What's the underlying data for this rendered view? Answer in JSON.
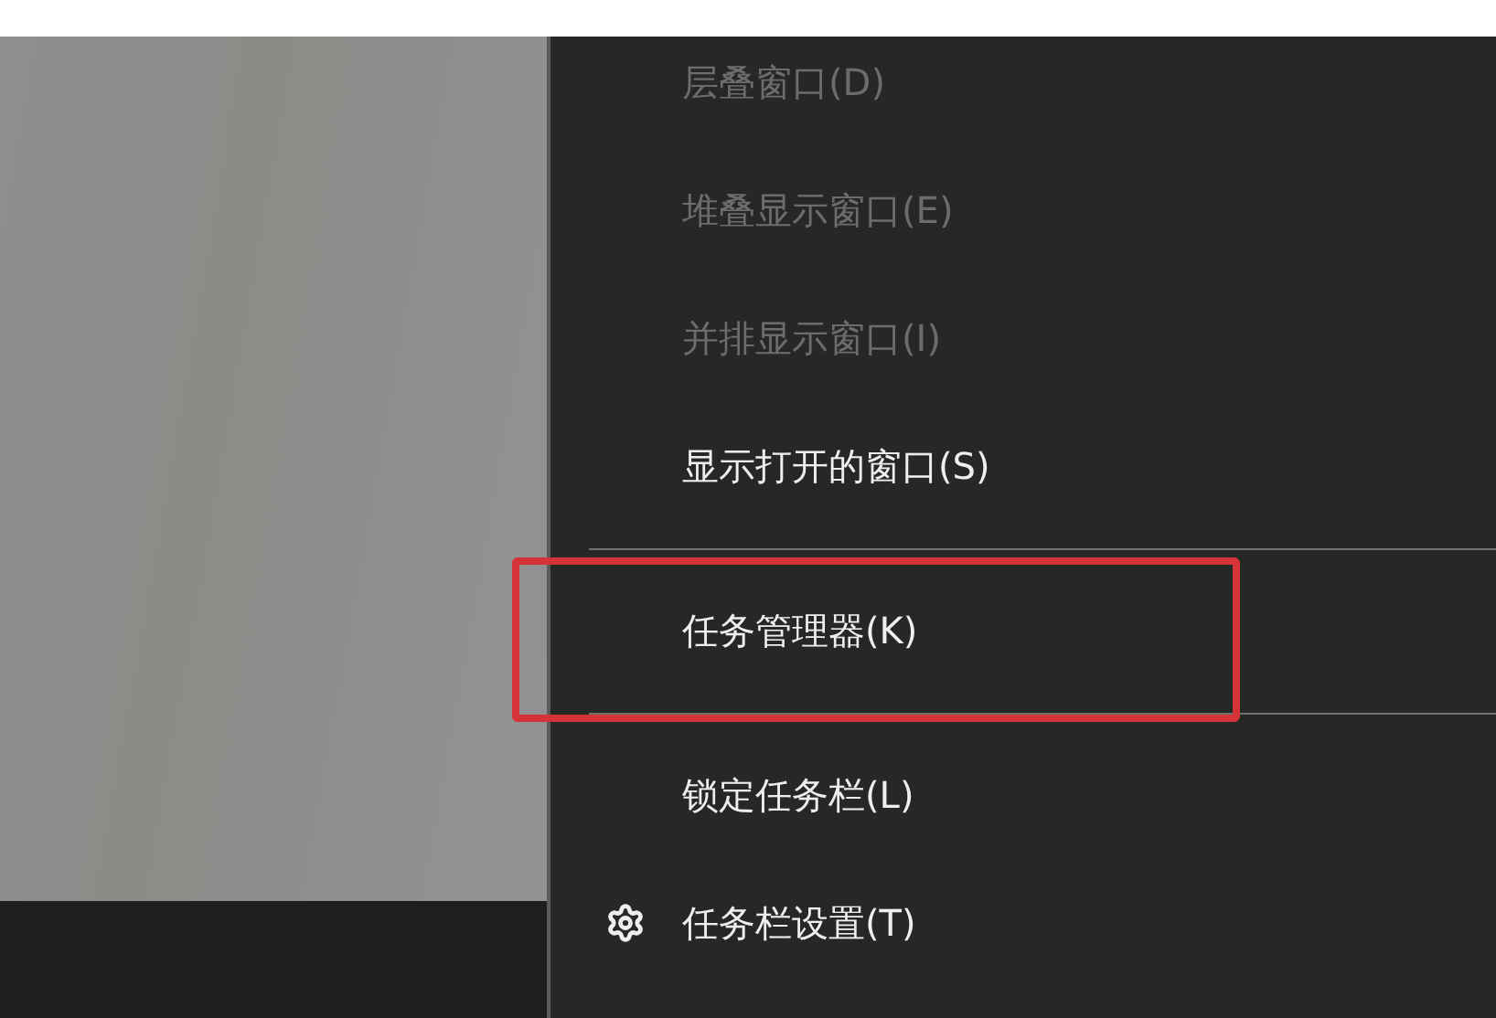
{
  "context_menu": {
    "items": [
      {
        "kind": "item",
        "label": "层叠窗口(D)",
        "disabled": true,
        "highlighted": false
      },
      {
        "kind": "item",
        "label": "堆叠显示窗口(E)",
        "disabled": true,
        "highlighted": false
      },
      {
        "kind": "item",
        "label": "并排显示窗口(I)",
        "disabled": true,
        "highlighted": false
      },
      {
        "kind": "item",
        "label": "显示打开的窗口(S)",
        "disabled": false,
        "highlighted": false
      },
      {
        "kind": "separator"
      },
      {
        "kind": "item",
        "label": "任务管理器(K)",
        "disabled": false,
        "highlighted": true
      },
      {
        "kind": "separator"
      },
      {
        "kind": "item",
        "label": "锁定任务栏(L)",
        "disabled": false,
        "highlighted": false
      },
      {
        "kind": "settings",
        "label": "任务栏设置(T)",
        "disabled": false,
        "highlighted": false
      }
    ]
  }
}
